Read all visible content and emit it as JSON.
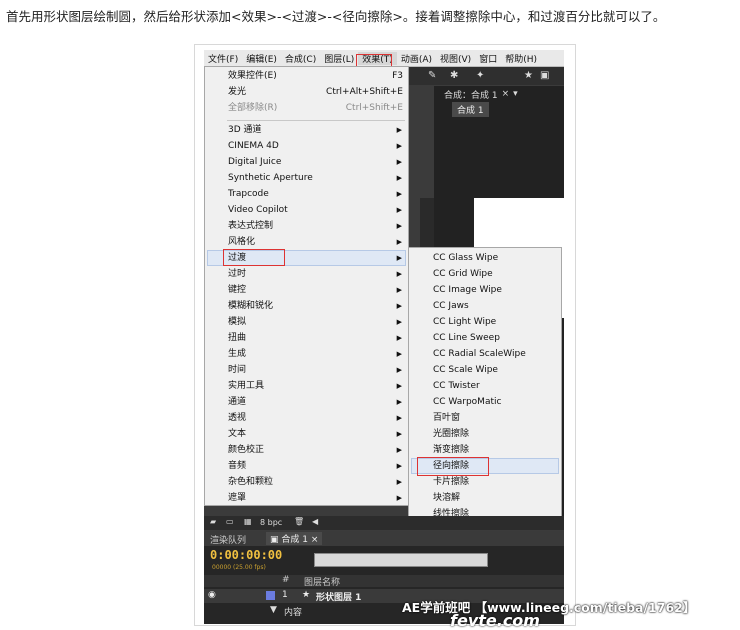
{
  "caption": "首先用形状图层绘制圆，然后给形状添加<效果>-<过渡>-<径向擦除>。接着调整擦除中心，和过渡百分比就可以了。",
  "menubar": [
    "文件(F)",
    "编辑(E)",
    "合成(C)",
    "图层(L)",
    "效果(T)",
    "动画(A)",
    "视图(V)",
    "窗口",
    "帮助(H)"
  ],
  "effects_menu": {
    "top": [
      {
        "label": "效果控件(E)",
        "shortcut": "F3"
      },
      {
        "label": "发光",
        "shortcut": "Ctrl+Alt+Shift+E"
      },
      {
        "label": "全部移除(R)",
        "shortcut": "Ctrl+Shift+E"
      }
    ],
    "categories": [
      "3D 通道",
      "CINEMA 4D",
      "Digital Juice",
      "Synthetic Aperture",
      "Trapcode",
      "Video Copilot",
      "表达式控制",
      "风格化",
      "过渡",
      "过时",
      "键控",
      "模糊和锐化",
      "模拟",
      "扭曲",
      "生成",
      "时间",
      "实用工具",
      "通道",
      "透视",
      "文本",
      "颜色校正",
      "音频",
      "杂色和颗粒",
      "遮罩"
    ]
  },
  "transition_submenu": [
    "CC Glass Wipe",
    "CC Grid Wipe",
    "CC Image Wipe",
    "CC Jaws",
    "CC Light Wipe",
    "CC Line Sweep",
    "CC Radial ScaleWipe",
    "CC Scale Wipe",
    "CC Twister",
    "CC WarpoMatic",
    "百叶窗",
    "光圈擦除",
    "渐变擦除",
    "径向擦除",
    "卡片擦除",
    "块溶解",
    "线性擦除"
  ],
  "comp": {
    "tab": "合成：合成 1",
    "sub": "合成 1"
  },
  "project_bar": {
    "bpc": "8 bpc"
  },
  "timeline": {
    "tab_render": "渲染队列",
    "tab_comp": "合成 1",
    "timecode": "0:00:00:00",
    "fps": "00000 (25.00 fps)",
    "col_num": "#",
    "col_name": "图层名称",
    "layer_num": "1",
    "layer_name": "形状图层 1",
    "content": "内容"
  },
  "watermark": "AE学前班吧 【www.lineeg.com/tieba/1762】",
  "logo": "fevte.com"
}
